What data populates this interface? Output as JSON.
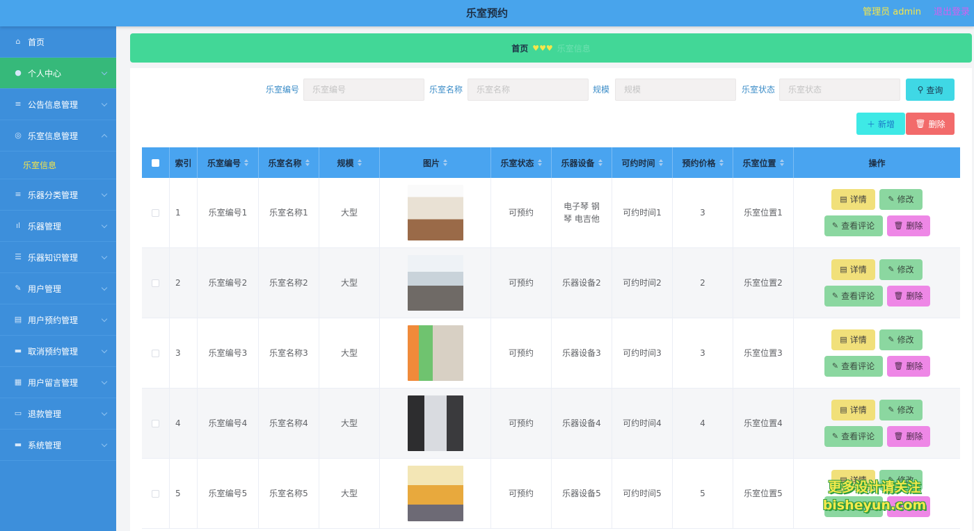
{
  "header": {
    "title": "乐室预约",
    "admin": "管理员 admin",
    "logout": "退出登录"
  },
  "sidebar": {
    "items": [
      {
        "label": "首页",
        "icon": "home-icon"
      },
      {
        "label": "个人中心",
        "icon": "user-icon"
      },
      {
        "label": "公告信息管理",
        "icon": "list-icon"
      },
      {
        "label": "乐室信息管理",
        "icon": "compass-icon"
      },
      {
        "label": "乐器分类管理",
        "icon": "list-icon"
      },
      {
        "label": "乐器管理",
        "icon": "bar-chart-icon"
      },
      {
        "label": "乐器知识管理",
        "icon": "sliders-icon"
      },
      {
        "label": "用户管理",
        "icon": "pen-icon"
      },
      {
        "label": "用户预约管理",
        "icon": "clipboard-icon"
      },
      {
        "label": "取消预约管理",
        "icon": "monitor-icon"
      },
      {
        "label": "用户留言管理",
        "icon": "briefcase-icon"
      },
      {
        "label": "退款管理",
        "icon": "chat-icon"
      },
      {
        "label": "系统管理",
        "icon": "monitor-icon"
      }
    ],
    "sub_item": "乐室信息"
  },
  "breadcrumb": {
    "home": "首页",
    "separator": "♥♥♥",
    "current": "乐室信息"
  },
  "search": {
    "code_label": "乐室编号",
    "code_placeholder": "乐室编号",
    "name_label": "乐室名称",
    "name_placeholder": "乐室名称",
    "scale_label": "规模",
    "scale_placeholder": "规模",
    "status_label": "乐室状态",
    "status_placeholder": "乐室状态",
    "query_button": "查询"
  },
  "actions": {
    "add": "新增",
    "delete": "删除"
  },
  "table": {
    "headers": [
      "索引",
      "乐室编号",
      "乐室名称",
      "规模",
      "图片",
      "乐室状态",
      "乐器设备",
      "可约时间",
      "预约价格",
      "乐室位置",
      "操作"
    ],
    "rows": [
      {
        "index": "1",
        "code": "乐室编号1",
        "name": "乐室名称1",
        "scale": "大型",
        "status": "可预约",
        "equipment": "电子琴 钢琴 电吉他",
        "time": "可约时间1",
        "price": "3",
        "location": "乐室位置1"
      },
      {
        "index": "2",
        "code": "乐室编号2",
        "name": "乐室名称2",
        "scale": "大型",
        "status": "可预约",
        "equipment": "乐器设备2",
        "time": "可约时间2",
        "price": "2",
        "location": "乐室位置2"
      },
      {
        "index": "3",
        "code": "乐室编号3",
        "name": "乐室名称3",
        "scale": "大型",
        "status": "可预约",
        "equipment": "乐器设备3",
        "time": "可约时间3",
        "price": "3",
        "location": "乐室位置3"
      },
      {
        "index": "4",
        "code": "乐室编号4",
        "name": "乐室名称4",
        "scale": "大型",
        "status": "可预约",
        "equipment": "乐器设备4",
        "time": "可约时间4",
        "price": "4",
        "location": "乐室位置4"
      },
      {
        "index": "5",
        "code": "乐室编号5",
        "name": "乐室名称5",
        "scale": "大型",
        "status": "可预约",
        "equipment": "乐器设备5",
        "time": "可约时间5",
        "price": "5",
        "location": "乐室位置5"
      }
    ],
    "row_actions": {
      "detail": "详情",
      "edit": "修改",
      "comment": "查看评论",
      "delete": "删除"
    }
  },
  "watermark": {
    "line1": "更多设计请关注",
    "line2": "bisheyun.com"
  },
  "colors": {
    "topbar": "#48a4ec",
    "sidebar": "#3d8fdb",
    "active": "#36b97a",
    "breadcrumb": "#42d797",
    "table_header": "#49a4f0"
  }
}
